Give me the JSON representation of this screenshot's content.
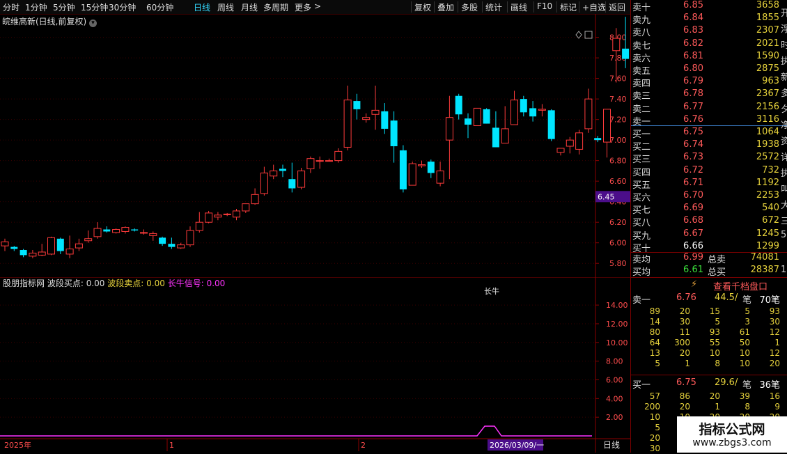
{
  "toolbar": {
    "periods": [
      "分时",
      "1分钟",
      "5分钟",
      "15分钟",
      "30分钟",
      "60分钟",
      "日线",
      "周线",
      "月线",
      "多周期",
      "更多"
    ],
    "active": "日线",
    "actions": [
      "复权",
      "叠加",
      "多股",
      "统计",
      "画线",
      "F10",
      "标记",
      "+自选",
      "返回"
    ]
  },
  "stock_title": "皖维高新(日线,前复权)",
  "price_axis": [
    "8.00",
    "7.80",
    "7.60",
    "7.40",
    "7.20",
    "7.00",
    "6.80",
    "6.60",
    "6.40",
    "6.20",
    "6.00",
    "5.80"
  ],
  "current_price_tag": "6.45",
  "indicator": {
    "name": "股朋指标网",
    "buy_label": "波段买点:",
    "buy_value": "0.00",
    "sell_label": "波段卖点:",
    "sell_value": "0.00",
    "bull_label": "长牛信号:",
    "bull_value": "0.00",
    "annotation": "长牛",
    "axis": [
      "14.00",
      "12.00",
      "10.00",
      "8.00",
      "6.00",
      "4.00",
      "2.00"
    ]
  },
  "timeline": {
    "year_label": "2025年",
    "m1": "1",
    "m2": "2",
    "cursor_date": "2026/03/09/一",
    "period_label": "日线"
  },
  "orderbook": {
    "sell": [
      {
        "label": "卖十",
        "price": "6.85",
        "vol": "3658"
      },
      {
        "label": "卖九",
        "price": "6.84",
        "vol": "1855"
      },
      {
        "label": "卖八",
        "price": "6.83",
        "vol": "2307"
      },
      {
        "label": "卖七",
        "price": "6.82",
        "vol": "2021"
      },
      {
        "label": "卖六",
        "price": "6.81",
        "vol": "1590"
      },
      {
        "label": "卖五",
        "price": "6.80",
        "vol": "2875"
      },
      {
        "label": "卖四",
        "price": "6.79",
        "vol": "963"
      },
      {
        "label": "卖三",
        "price": "6.78",
        "vol": "2367"
      },
      {
        "label": "卖二",
        "price": "6.77",
        "vol": "2156"
      },
      {
        "label": "卖一",
        "price": "6.76",
        "vol": "3116"
      }
    ],
    "buy": [
      {
        "label": "买一",
        "price": "6.75",
        "vol": "1064"
      },
      {
        "label": "买二",
        "price": "6.74",
        "vol": "1938"
      },
      {
        "label": "买三",
        "price": "6.73",
        "vol": "2572"
      },
      {
        "label": "买四",
        "price": "6.72",
        "vol": "732"
      },
      {
        "label": "买五",
        "price": "6.71",
        "vol": "1192"
      },
      {
        "label": "买六",
        "price": "6.70",
        "vol": "2253"
      },
      {
        "label": "买七",
        "price": "6.69",
        "vol": "540"
      },
      {
        "label": "买八",
        "price": "6.68",
        "vol": "672"
      },
      {
        "label": "买九",
        "price": "6.67",
        "vol": "1245"
      },
      {
        "label": "买十",
        "price": "6.66",
        "vol": "1299"
      }
    ],
    "avg_sell_label": "卖均",
    "avg_sell_price": "6.99",
    "total_sell_label": "总卖",
    "total_sell": "74081",
    "avg_buy_label": "买均",
    "avg_buy_price": "6.61",
    "total_buy_label": "总买",
    "total_buy": "28387",
    "side_chars": [
      "开",
      "浮",
      "时",
      "执",
      "新",
      "多",
      "夕",
      "净",
      "资",
      "详",
      "执",
      "叫",
      "大",
      "三",
      "5"
    ],
    "side_chars_bottom": [
      "1"
    ]
  },
  "qiandang": {
    "button": "查看千档盘口",
    "sell1_label": "卖一",
    "sell1_price": "6.76",
    "sell1_avg": "44.5/",
    "sell1_unit": "笔",
    "sell1_count": "70笔",
    "sell_ticks": [
      [
        "89",
        "20",
        "15",
        "5",
        "93"
      ],
      [
        "14",
        "30",
        "5",
        "3",
        "30"
      ],
      [
        "80",
        "11",
        "93",
        "61",
        "12"
      ],
      [
        "64",
        "300",
        "55",
        "50",
        "1"
      ],
      [
        "13",
        "20",
        "10",
        "10",
        "12"
      ],
      [
        "5",
        "1",
        "8",
        "10",
        "20"
      ]
    ],
    "buy1_label": "买一",
    "buy1_price": "6.75",
    "buy1_avg": "29.6/",
    "buy1_unit": "笔",
    "buy1_count": "36笔",
    "buy_ticks": [
      [
        "57",
        "86",
        "20",
        "39",
        "16"
      ],
      [
        "200",
        "20",
        "1",
        "8",
        "9"
      ],
      [
        "10",
        "10",
        "20",
        "20",
        "20"
      ],
      [
        "5",
        "",
        "",
        "",
        ""
      ],
      [
        "20",
        "1",
        "",
        "",
        ""
      ],
      [
        "30",
        "",
        "",
        "",
        ""
      ]
    ]
  },
  "watermark": {
    "title": "指标公式网",
    "url": "www.zbgs3.com"
  },
  "colors": {
    "up": "#ff3b3b",
    "down": "#00e5ff",
    "axis": "#8b0000",
    "buy_line": "#ff33ff"
  },
  "chart_data": {
    "type": "candlestick",
    "ylim": [
      5.72,
      8.16
    ],
    "candles": [
      [
        5.97,
        6.01,
        5.92,
        6.04
      ],
      [
        5.96,
        5.94,
        5.92,
        5.97
      ],
      [
        5.93,
        5.88,
        5.86,
        5.94
      ],
      [
        5.87,
        5.9,
        5.85,
        5.93
      ],
      [
        5.88,
        5.91,
        5.87,
        5.99
      ],
      [
        5.89,
        6.05,
        5.88,
        6.06
      ],
      [
        6.04,
        5.92,
        5.89,
        6.05
      ],
      [
        5.89,
        5.94,
        5.85,
        6.07
      ],
      [
        5.95,
        5.99,
        5.92,
        6.04
      ],
      [
        6.02,
        6.04,
        6.0,
        6.12
      ],
      [
        6.06,
        6.14,
        6.04,
        6.2
      ],
      [
        6.13,
        6.11,
        6.1,
        6.16
      ],
      [
        6.1,
        6.13,
        6.09,
        6.14
      ],
      [
        6.11,
        6.15,
        6.09,
        6.16
      ],
      [
        6.13,
        6.12,
        6.11,
        6.14
      ],
      [
        6.1,
        6.1,
        6.08,
        6.13
      ],
      [
        6.07,
        6.09,
        6.02,
        6.11
      ],
      [
        6.05,
        5.99,
        5.97,
        6.06
      ],
      [
        5.99,
        5.96,
        5.94,
        6.05
      ],
      [
        5.95,
        5.98,
        5.94,
        6.0
      ],
      [
        5.98,
        6.12,
        5.96,
        6.16
      ],
      [
        6.12,
        6.2,
        6.1,
        6.3
      ],
      [
        6.2,
        6.29,
        6.19,
        6.31
      ],
      [
        6.25,
        6.27,
        6.22,
        6.3
      ],
      [
        6.28,
        6.28,
        6.26,
        6.29
      ],
      [
        6.25,
        6.31,
        6.22,
        6.33
      ],
      [
        6.31,
        6.38,
        6.29,
        6.38
      ],
      [
        6.38,
        6.47,
        6.37,
        6.53
      ],
      [
        6.48,
        6.68,
        6.46,
        6.74
      ],
      [
        6.65,
        6.7,
        6.62,
        6.76
      ],
      [
        6.72,
        6.7,
        6.64,
        6.76
      ],
      [
        6.62,
        6.53,
        6.49,
        6.78
      ],
      [
        6.54,
        6.7,
        6.52,
        6.73
      ],
      [
        6.72,
        6.82,
        6.68,
        6.84
      ],
      [
        6.8,
        6.8,
        6.72,
        6.84
      ],
      [
        6.8,
        6.8,
        6.8,
        6.82
      ],
      [
        6.8,
        6.89,
        6.78,
        6.92
      ],
      [
        6.93,
        7.39,
        6.9,
        7.53
      ],
      [
        7.38,
        7.3,
        7.2,
        7.45
      ],
      [
        7.2,
        7.22,
        7.17,
        7.26
      ],
      [
        7.25,
        7.29,
        7.1,
        7.53
      ],
      [
        7.28,
        7.11,
        7.06,
        7.36
      ],
      [
        7.19,
        6.94,
        6.78,
        7.28
      ],
      [
        6.9,
        6.52,
        6.49,
        6.95
      ],
      [
        6.56,
        6.77,
        6.57,
        6.79
      ],
      [
        6.75,
        6.76,
        6.73,
        6.8
      ],
      [
        6.79,
        6.68,
        6.63,
        6.81
      ],
      [
        6.58,
        6.7,
        6.55,
        6.79
      ],
      [
        7.0,
        7.22,
        6.62,
        7.43
      ],
      [
        7.43,
        7.25,
        7.2,
        7.45
      ],
      [
        7.21,
        7.15,
        7.02,
        7.26
      ],
      [
        7.14,
        7.31,
        7.14,
        7.31
      ],
      [
        7.3,
        7.16,
        7.16,
        7.31
      ],
      [
        7.12,
        6.93,
        6.93,
        7.28
      ],
      [
        6.97,
        7.11,
        6.97,
        7.33
      ],
      [
        7.15,
        7.39,
        7.15,
        7.48
      ],
      [
        7.4,
        7.27,
        7.23,
        7.43
      ],
      [
        7.31,
        7.23,
        7.18,
        7.38
      ],
      [
        7.29,
        7.3,
        7.23,
        7.35
      ],
      [
        7.29,
        7.01,
        6.99,
        7.3
      ],
      [
        6.88,
        6.92,
        6.85,
        6.92
      ],
      [
        6.94,
        7.0,
        6.87,
        7.03
      ],
      [
        6.91,
        7.07,
        6.86,
        7.1
      ],
      [
        7.11,
        7.4,
        7.07,
        7.5
      ],
      [
        7.02,
        7.0,
        6.98,
        7.04
      ],
      [
        6.98,
        7.3,
        6.83,
        7.3
      ],
      [
        7.87,
        7.99,
        7.56,
        8.09
      ],
      [
        7.89,
        7.79,
        7.7,
        8.2
      ],
      [
        7.75,
        7.47,
        7.46,
        8.07
      ]
    ]
  }
}
